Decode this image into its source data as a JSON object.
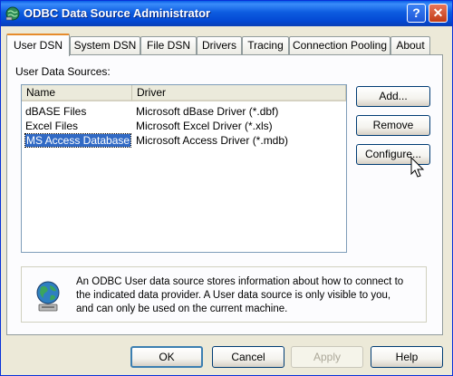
{
  "window": {
    "title": "ODBC Data Source Administrator",
    "help_glyph": "?",
    "close_glyph": "✕"
  },
  "tabs": [
    {
      "label": "User DSN",
      "active": true
    },
    {
      "label": "System DSN"
    },
    {
      "label": "File DSN"
    },
    {
      "label": "Drivers"
    },
    {
      "label": "Tracing"
    },
    {
      "label": "Connection Pooling"
    },
    {
      "label": "About"
    }
  ],
  "user_dsn": {
    "label": "User Data Sources:",
    "columns": [
      "Name",
      "Driver"
    ],
    "rows": [
      {
        "name": "dBASE Files",
        "driver": "Microsoft dBase Driver (*.dbf)"
      },
      {
        "name": "Excel Files",
        "driver": "Microsoft Excel Driver (*.xls)"
      },
      {
        "name": "MS Access Database",
        "driver": "Microsoft Access Driver (*.mdb)",
        "selected": true
      }
    ],
    "buttons": {
      "add": "Add...",
      "remove": "Remove",
      "configure": "Configure..."
    },
    "info": {
      "lines": [
        "An ODBC User data source stores information about how to connect to",
        "the indicated data provider.  A User data source is only visible to you,",
        "and can only be used on the current machine."
      ]
    }
  },
  "footer": {
    "ok": "OK",
    "cancel": "Cancel",
    "apply": "Apply",
    "help": "Help"
  },
  "icons": {
    "app": "odbc-globe-icon",
    "info": "globe-info-icon",
    "cursor": "mouse-pointer-icon"
  },
  "colors": {
    "titlebar": "#0A5FE6",
    "selection": "#316AC5",
    "tab_active_accent": "#E68B2C",
    "face": "#ECE9D8"
  }
}
